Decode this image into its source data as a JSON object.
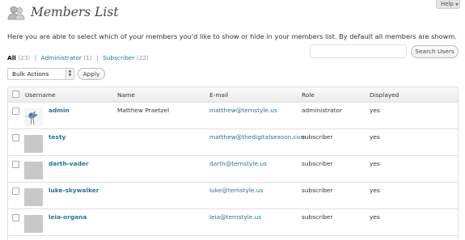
{
  "help": {
    "label": "Help"
  },
  "header": {
    "title": "Members List",
    "icon": "users-icon"
  },
  "intro_text": "Here you are able to select which of your members you'd like to show or hide in your members list. By default all members are showm.",
  "filters": [
    {
      "label": "All",
      "count": "(23)",
      "current": true
    },
    {
      "label": "Administrator",
      "count": "(1)",
      "current": false
    },
    {
      "label": "Subscriber",
      "count": "(22)",
      "current": false
    }
  ],
  "search": {
    "value": "",
    "button_label": "Search Users"
  },
  "bulk": {
    "selected": "Bulk Actions",
    "apply_label": "Apply"
  },
  "columns": {
    "username": "Username",
    "name": "Name",
    "email": "E-mail",
    "role": "Role",
    "displayed": "Displayed"
  },
  "rows": [
    {
      "username": "admin",
      "name": "Matthew Praetzel",
      "email": "matthew@ternstyle.us",
      "role": "administrator",
      "displayed": "yes",
      "avatar": "custom"
    },
    {
      "username": "testy",
      "name": "",
      "email": "matthew@thedigitalseason.com",
      "role": "subscriber",
      "displayed": "yes",
      "avatar": "default"
    },
    {
      "username": "darth-vader",
      "name": "",
      "email": "darth@ternstyle.us",
      "role": "subscriber",
      "displayed": "yes",
      "avatar": "default"
    },
    {
      "username": "luke-skywalker",
      "name": "",
      "email": "luke@ternstyle.us",
      "role": "subscriber",
      "displayed": "yes",
      "avatar": "default"
    },
    {
      "username": "leia-organa",
      "name": "",
      "email": "leia@ternstyle.us",
      "role": "subscriber",
      "displayed": "yes",
      "avatar": "default"
    }
  ],
  "colors": {
    "link": "#21759b",
    "text": "#333333",
    "border": "#dfdfdf"
  }
}
